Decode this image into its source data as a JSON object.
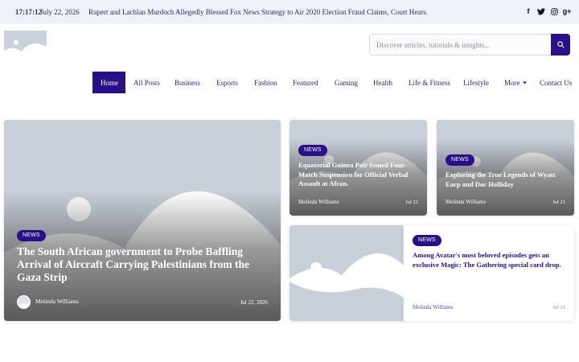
{
  "topbar": {
    "time": "17:17:12",
    "date": "July 22, 2026",
    "ticker": "Rupert and Lachlan Murdoch Allegedly Blessed Fox News Strategy to Air 2020 Election Fraud Claims, Court Hears.",
    "social": [
      "facebook-icon",
      "twitter-icon",
      "instagram-icon",
      "google-plus-icon"
    ]
  },
  "search": {
    "placeholder": "Discover articles, tutorials & insights..."
  },
  "nav": {
    "items": [
      "Home",
      "All Posts",
      "Business",
      "Esports",
      "Fashion",
      "Featured",
      "Gaming",
      "Health",
      "Life & Fitness",
      "Lifestyle",
      "More",
      "Contact Us"
    ]
  },
  "cards": [
    {
      "badge": "NEWS",
      "title": "The South African government to Probe Baffling Arrival of Aircraft Carrying Palestinians from the Gaza Strip",
      "author": "Melinda Williams",
      "date": "Jul 22, 2026"
    },
    {
      "badge": "NEWS",
      "title": "Equatorial Guinea Pair Issued Four-Match Suspension for Official Verbal Assault at Afcon.",
      "author": "Melinda Williams",
      "date": "Jul 22"
    },
    {
      "badge": "NEWS",
      "title": "Exploring the True Legends of Wyatt Earp and Doc Holliday",
      "author": "Melinda Williams",
      "date": "Jul 21"
    },
    {
      "badge": "NEWS",
      "title": "Among Avatar's most beloved episodes gets an exclusive Magic: The Gathering special card drop.",
      "author": "Melinda Williams",
      "date": "Jul 21"
    }
  ],
  "colors": {
    "accent": "#2b0f88",
    "topbar_bg": "#eef2fb",
    "text": "#2d2a6e",
    "placeholder": "#c7cfd9"
  }
}
